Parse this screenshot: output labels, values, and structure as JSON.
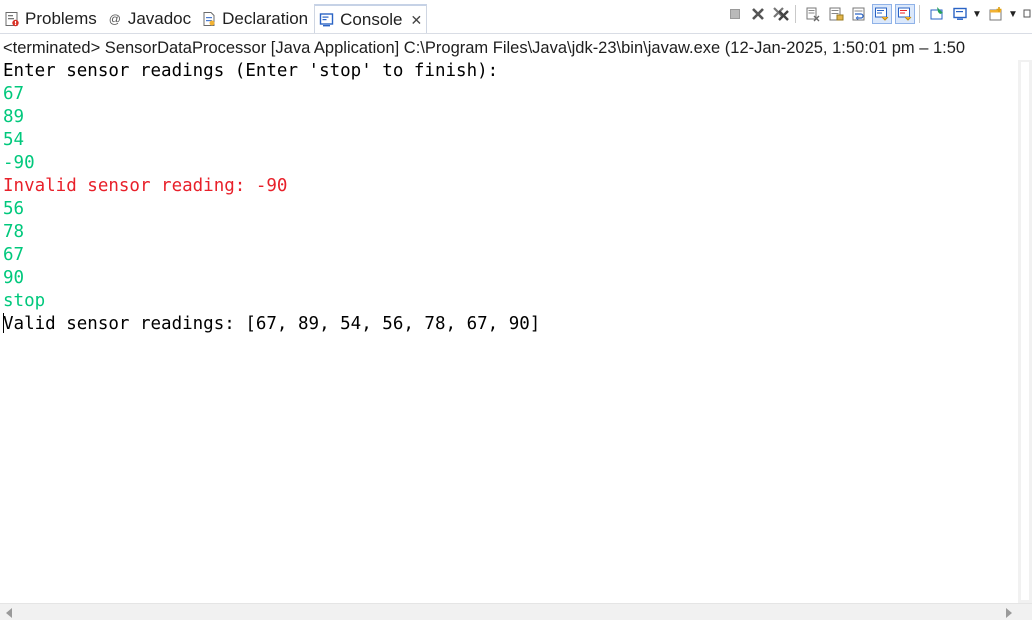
{
  "tabs": [
    {
      "label": "Problems",
      "icon": "problems-icon",
      "active": false
    },
    {
      "label": "Javadoc",
      "icon": "javadoc-at-icon",
      "active": false
    },
    {
      "label": "Declaration",
      "icon": "declaration-icon",
      "active": false
    },
    {
      "label": "Console",
      "icon": "console-icon",
      "active": true
    }
  ],
  "tab_close_glyph": "✕",
  "status": "<terminated> SensorDataProcessor [Java Application] C:\\Program Files\\Java\\jdk-23\\bin\\javaw.exe  (12-Jan-2025, 1:50:01 pm – 1:50",
  "console": {
    "lines": [
      {
        "text": "Enter sensor readings (Enter 'stop' to finish):",
        "kind": "out"
      },
      {
        "text": "67",
        "kind": "in"
      },
      {
        "text": "89",
        "kind": "in"
      },
      {
        "text": "54",
        "kind": "in"
      },
      {
        "text": "-90",
        "kind": "in"
      },
      {
        "text": "Invalid sensor reading: -90",
        "kind": "err"
      },
      {
        "text": "56",
        "kind": "in"
      },
      {
        "text": "78",
        "kind": "in"
      },
      {
        "text": "67",
        "kind": "in"
      },
      {
        "text": "90",
        "kind": "in"
      },
      {
        "text": "stop",
        "kind": "in"
      },
      {
        "text": "Valid sensor readings: [67, 89, 54, 56, 78, 67, 90]",
        "kind": "out"
      }
    ]
  },
  "colors": {
    "stdout": "#000000",
    "stdin": "#00c87c",
    "stderr": "#e8202a",
    "accent": "#2a63c5"
  }
}
